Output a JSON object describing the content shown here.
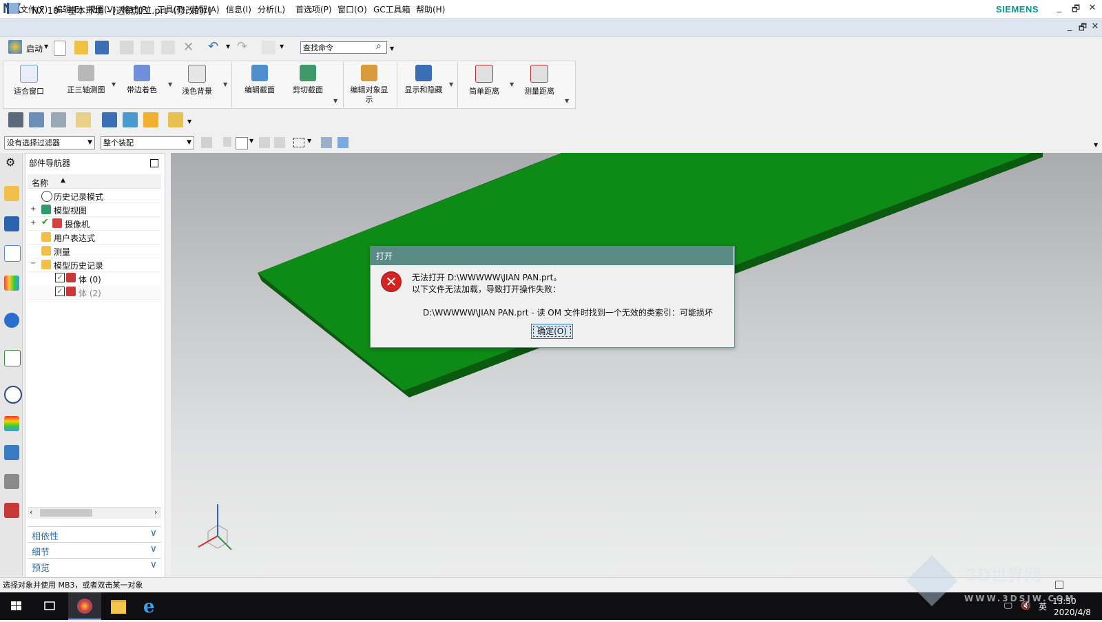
{
  "window": {
    "logo": "NX",
    "title": "NX 10 - 基本环境 - [透镜加工.prt（修改的）]",
    "brand": "SIEMENS",
    "minimize": "_",
    "restore": "🗗",
    "close": "✕"
  },
  "menu": {
    "items": [
      "文件(F)",
      "编辑(E)",
      "视图(V)",
      "格式(R)",
      "工具(T)",
      "装配(A)",
      "信息(I)",
      "分析(L)",
      "首选项(P)",
      "窗口(O)",
      "GC工具箱",
      "帮助(H)"
    ]
  },
  "quickbar": {
    "start_label": "启动",
    "search_placeholder": "查找命令"
  },
  "ribbon": {
    "buttons": [
      "适合窗口",
      "正三轴测图",
      "带边着色",
      "浅色背景",
      "编辑截面",
      "剪切截面",
      "编辑对象显示",
      "显示和隐藏",
      "简单距离",
      "测量距离"
    ]
  },
  "selection": {
    "filter": "没有选择过滤器",
    "scope": "整个装配"
  },
  "navigator": {
    "title": "部件导航器",
    "column": "名称",
    "rows": [
      {
        "label": "历史记录模式"
      },
      {
        "label": "模型视图"
      },
      {
        "label": "摄像机"
      },
      {
        "label": "用户表达式"
      },
      {
        "label": "测量"
      },
      {
        "label": "模型历史记录"
      },
      {
        "label": "体 (0)"
      },
      {
        "label": "体 (2)"
      }
    ],
    "panels": [
      "相依性",
      "细节",
      "预览"
    ]
  },
  "dialog": {
    "title": "打开",
    "line1": "无法打开 D:\\WWWWW\\JIAN  PAN.prt。",
    "line2": "以下文件无法加载，导致打开操作失败：",
    "detail": "D:\\WWWWW\\JIAN  PAN.prt - 读 OM 文件时找到一个无效的类索引：可能损坏",
    "ok_label": "确定(O)"
  },
  "status": {
    "text": "选择对象并使用 MB3，或者双击某一对象"
  },
  "taskbar": {
    "time": "13:50",
    "date": "2020/4/8",
    "ime": "英"
  },
  "watermark": {
    "brand": "3D世界网",
    "url": "WWW.3DSJW.COM"
  },
  "colors": {
    "model_top": "#0e8a16",
    "model_side": "#0a5a10",
    "dialog_titlebar": "#5a8a84",
    "menubar": "#dde6ef"
  }
}
